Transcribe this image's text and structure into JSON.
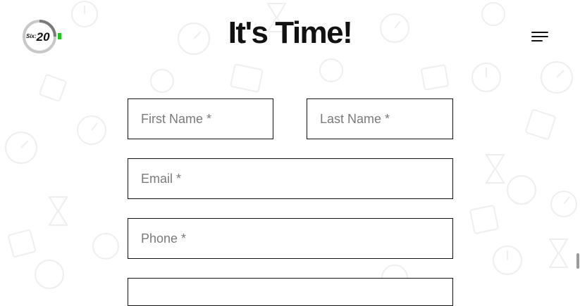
{
  "header": {
    "logo_text": "Six:20",
    "title": "It's Time!"
  },
  "form": {
    "first_name_placeholder": "First Name *",
    "last_name_placeholder": "Last Name *",
    "email_placeholder": "Email *",
    "phone_placeholder": "Phone *"
  },
  "icons": {
    "menu": "hamburger-menu-icon",
    "background": "clock-pattern"
  },
  "colors": {
    "logo_accent": "#22c322",
    "text": "#111111"
  }
}
